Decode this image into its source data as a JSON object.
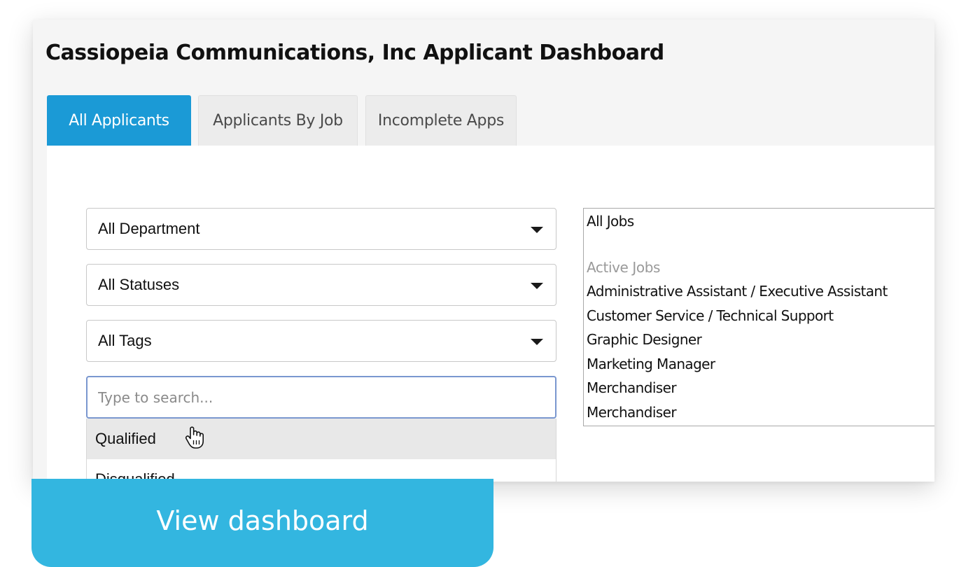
{
  "page": {
    "title": "Cassiopeia Communications, Inc Applicant Dashboard"
  },
  "tabs": [
    {
      "label": "All Applicants",
      "active": true
    },
    {
      "label": "Applicants By Job",
      "active": false
    },
    {
      "label": "Incomplete Apps",
      "active": false
    }
  ],
  "filters": {
    "department": {
      "value": "All Department"
    },
    "status": {
      "value": "All Statuses"
    },
    "tags": {
      "value": "All Tags"
    }
  },
  "search": {
    "placeholder": "Type to search...",
    "value": "",
    "options": [
      "Qualified",
      "Disqualified"
    ],
    "hovered_option": "Qualified"
  },
  "jobs_list": {
    "all_label": "All Jobs",
    "group_label": "Active Jobs",
    "items": [
      "Administrative Assistant / Executive Assistant",
      "Customer Service / Technical Support",
      "Graphic Designer",
      "Marketing Manager",
      "Merchandiser",
      "Merchandiser"
    ]
  },
  "cta": {
    "label": "View dashboard"
  },
  "colors": {
    "accent": "#1b9ad6",
    "cta": "#33b6e0",
    "focus_border": "#7a97cf",
    "hover_row": "#e8e8e8"
  },
  "icons": {
    "select_caret": "caret-down-icon",
    "pointer": "hand-cursor-icon"
  }
}
